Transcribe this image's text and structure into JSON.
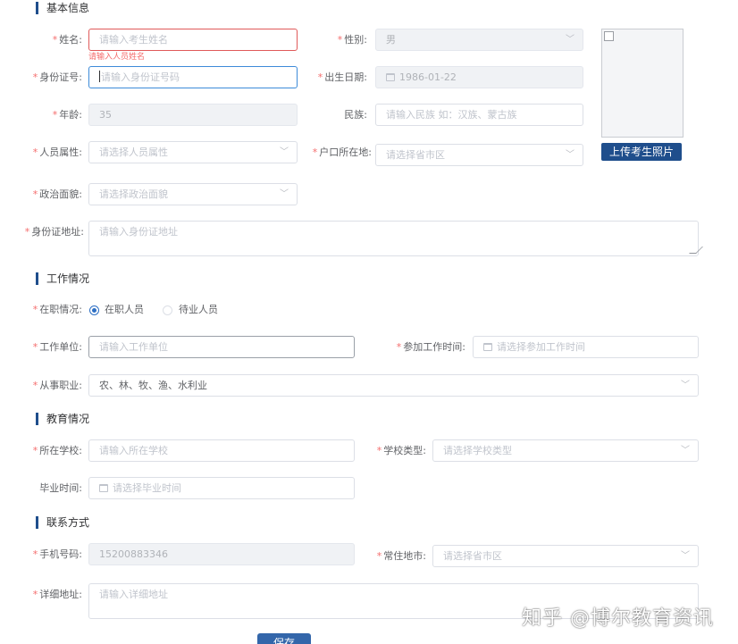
{
  "sections": {
    "basic": "基本信息",
    "work": "工作情况",
    "education": "教育情况",
    "contact": "联系方式"
  },
  "required_mark": "*",
  "basic": {
    "name": {
      "label": "姓名:",
      "placeholder": "请输入考生姓名",
      "error": "请输入人员姓名"
    },
    "gender": {
      "label": "性别:",
      "value": "男"
    },
    "id_number": {
      "label": "身份证号:",
      "placeholder": "请输入身份证号码"
    },
    "birth_date": {
      "label": "出生日期:",
      "value": "1986-01-22"
    },
    "age": {
      "label": "年龄:",
      "value": "35"
    },
    "ethnicity": {
      "label": "民族:",
      "placeholder": "请输入民族 如：汉族、蒙古族"
    },
    "person_type": {
      "label": "人员属性:",
      "placeholder": "请选择人员属性"
    },
    "household": {
      "label": "户口所在地:",
      "placeholder": "请选择省市区"
    },
    "political": {
      "label": "政治面貌:",
      "placeholder": "请选择政治面貌"
    },
    "id_address": {
      "label": "身份证地址:",
      "placeholder": "请输入身份证地址"
    },
    "upload_button": "上传考生照片"
  },
  "work": {
    "status": {
      "label": "在职情况:",
      "options": [
        "在职人员",
        "待业人员"
      ],
      "selected": "在职人员"
    },
    "employer": {
      "label": "工作单位:",
      "placeholder": "请输入工作单位"
    },
    "start_time": {
      "label": "参加工作时间:",
      "placeholder": "请选择参加工作时间"
    },
    "occupation": {
      "label": "从事职业:",
      "value": "农、林、牧、渔、水利业"
    }
  },
  "education": {
    "school": {
      "label": "所在学校:",
      "placeholder": "请输入所在学校"
    },
    "school_type": {
      "label": "学校类型:",
      "placeholder": "请选择学校类型"
    },
    "graduation": {
      "label": "毕业时间:",
      "placeholder": "请选择毕业时间"
    }
  },
  "contact": {
    "phone": {
      "label": "手机号码:",
      "value": "15200883346"
    },
    "residence": {
      "label": "常住地市:",
      "placeholder": "请选择省市区"
    },
    "address": {
      "label": "详细地址:",
      "placeholder": "请输入详细地址"
    }
  },
  "save_button": "保存",
  "watermark": "知乎 @博尔教育资讯",
  "colors": {
    "accent": "#1f4e8c",
    "required": "#f56c6c",
    "focus_border": "#3d8bd9",
    "error_border": "#e05a5a"
  }
}
